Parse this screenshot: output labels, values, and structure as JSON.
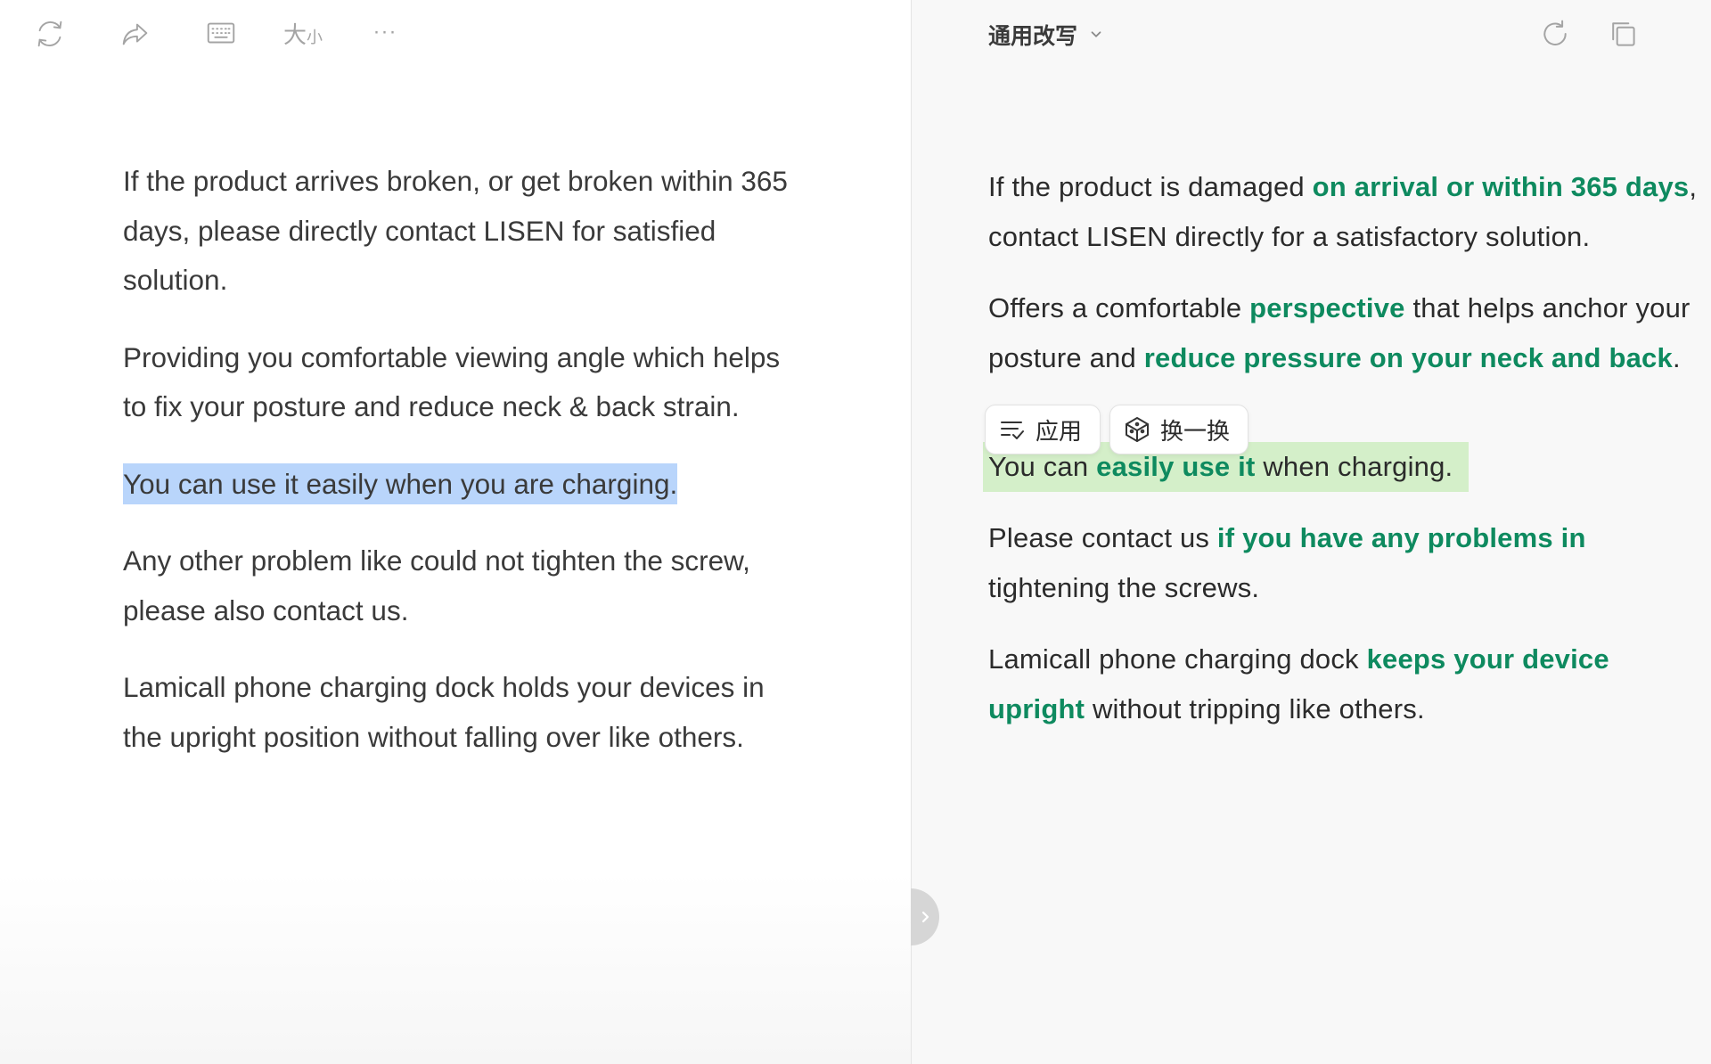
{
  "left_toolbar": {
    "buttons": [
      "refresh-icon",
      "share-icon",
      "keyboard-icon"
    ],
    "size_label_big": "大",
    "size_label_small": "小",
    "more_label": "···"
  },
  "left_paragraphs": {
    "p1": "If the product arrives broken, or get broken within 365 days, please directly contact LISEN for satisfied solution.",
    "p2": "Providing you comfortable viewing angle which helps to fix your posture and reduce neck & back strain.",
    "p3": "You can use it easily when you are charging.",
    "p4": "Any other problem like could not tighten the screw, please also contact us.",
    "p5": "Lamicall phone charging dock holds your devices in the upright position without falling over like others."
  },
  "right_header": {
    "mode_label": "通用改写",
    "icons": [
      "redo-icon",
      "copy-icon"
    ]
  },
  "right_paragraphs": {
    "p1": {
      "a": "If the product is damaged ",
      "b": "on arrival or within 365 days",
      "c": ", contact LISEN directly for a satisfactory solution."
    },
    "p2": {
      "a": "Offers a comfortable ",
      "b": "perspective",
      "c": " that helps anchor your posture and ",
      "d": "reduce pressure on your neck and back",
      "e": "."
    },
    "p3": {
      "a": "You can ",
      "b": "easily use it",
      "c": " when charging."
    },
    "p4": {
      "a": "Please contact us ",
      "b": "if you have any problems in",
      "c": " tightening the screws."
    },
    "p5": {
      "a": "Lamicall phone charging dock ",
      "b": "keeps your device upright",
      "c": " without tripping like others."
    }
  },
  "actions": {
    "apply_label": "应用",
    "swap_label": "换一换"
  },
  "colors": {
    "highlight_green_text": "#0e8a5f",
    "selection_blue": "#b9d5fb",
    "selection_green": "#d4efc9"
  }
}
